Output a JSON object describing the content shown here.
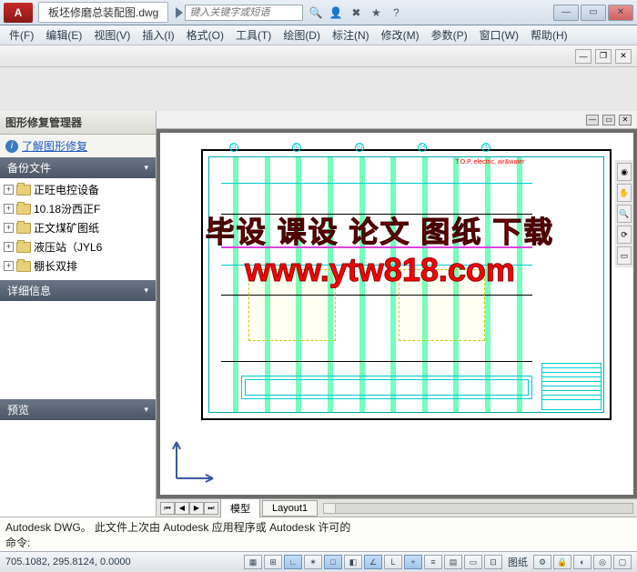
{
  "titlebar": {
    "app_letter": "A",
    "doc_name": "板坯修磨总装配图.dwg",
    "search_placeholder": "键入关键字或短语"
  },
  "menu": {
    "items": [
      "件(F)",
      "编辑(E)",
      "视图(V)",
      "插入(I)",
      "格式(O)",
      "工具(T)",
      "绘图(D)",
      "标注(N)",
      "修改(M)",
      "参数(P)",
      "窗口(W)",
      "帮助(H)"
    ]
  },
  "left_panel": {
    "title": "图形修复管理器",
    "info_link": "了解图形修复",
    "backup_header": "备份文件",
    "tree": [
      {
        "label": "正旺电控设备"
      },
      {
        "label": "10.18汾西正F"
      },
      {
        "label": "正文煤矿图纸"
      },
      {
        "label": "液压站（JYL6"
      },
      {
        "label": "棚长双排"
      }
    ],
    "detail_header": "详细信息",
    "preview_header": "预览"
  },
  "model_tabs": {
    "tabs": [
      "模型",
      "Layout1"
    ]
  },
  "cmdline": {
    "line1": "Autodesk DWG。 此文件上次由 Autodesk 应用程序或 Autodesk 许可的",
    "line2": "命令:"
  },
  "statusbar": {
    "coords": "705.1082, 295.8124, 0.0000",
    "paper_label": "图纸"
  },
  "watermark": {
    "line1": "毕设 课设 论文 图纸 下载",
    "line2": "www.ytw818.com"
  },
  "drawing": {
    "tag_text": "T.O.P. electric, air&water"
  }
}
